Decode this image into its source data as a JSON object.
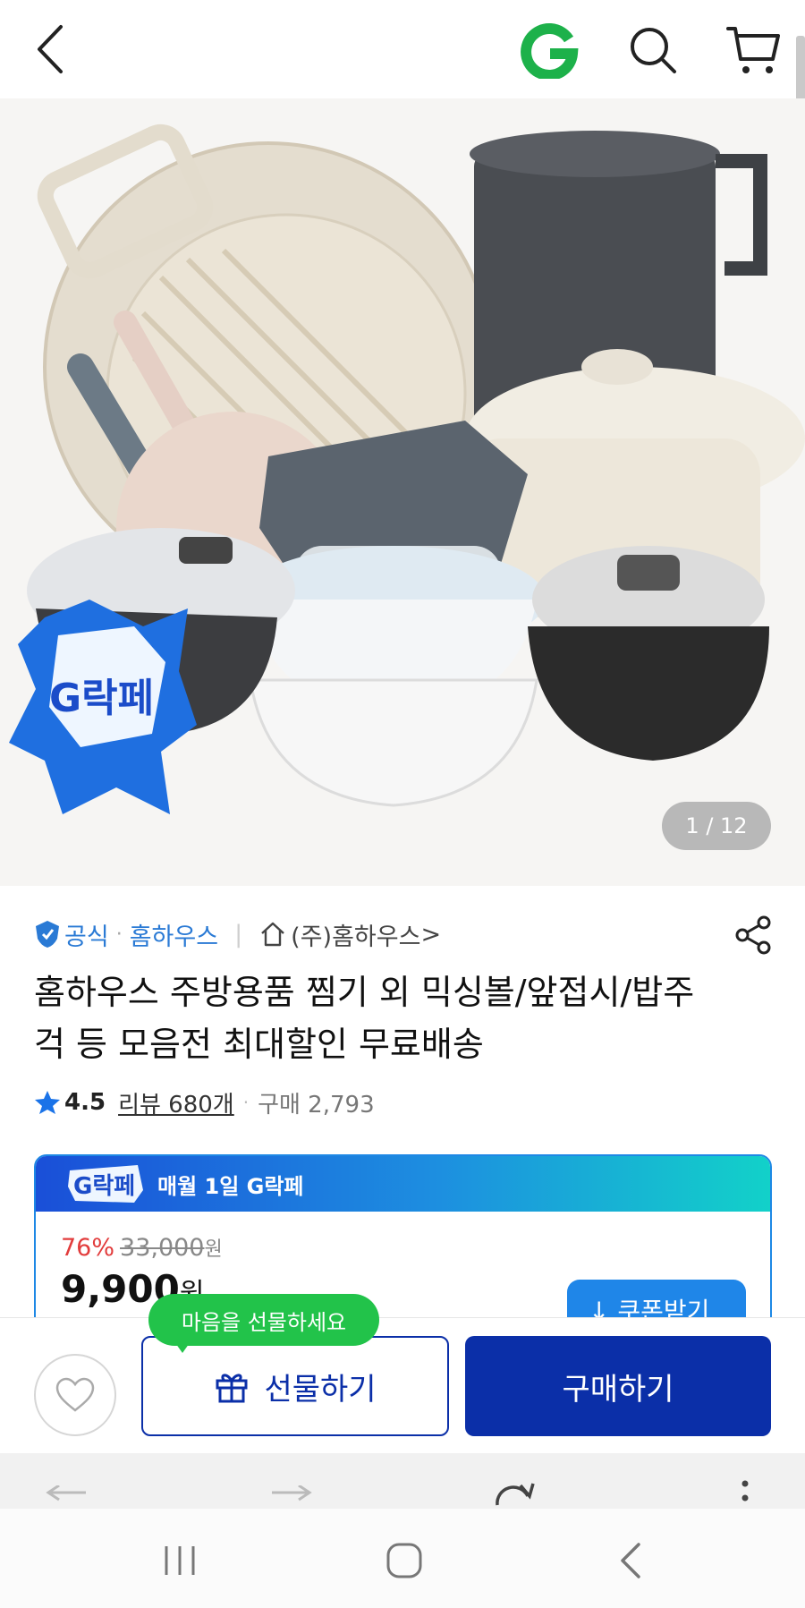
{
  "header": {
    "back_icon": "chevron-left-icon",
    "logo_icon": "g-logo-icon",
    "search_icon": "search-icon",
    "cart_icon": "cart-icon"
  },
  "gallery": {
    "counter": "1 / 12",
    "badge_text": "G락페"
  },
  "product": {
    "official_label": "공식",
    "brand_name": "홈하우스",
    "store_name": "(주)홈하우스",
    "store_chevron": ">",
    "title": "홈하우스 주방용품 찜기 외 믹싱볼/앞접시/밥주걱 등 모음전 최대할인 무료배송",
    "rating": "4.5",
    "reviews": "리뷰 680개",
    "purchases": "구매 2,793"
  },
  "promo": {
    "badge_text": "G락페",
    "header_text": "매월 1일 G락페",
    "discount": "76%",
    "original_price": "33,000",
    "original_won": "원",
    "price": "9,900",
    "price_won": "원",
    "coupon_label": "↓ 쿠폰받기"
  },
  "actions": {
    "tooltip": "마음을 선물하세요",
    "gift_label": "선물하기",
    "buy_label": "구매하기"
  },
  "colors": {
    "primary_blue": "#0b2fa8",
    "link_blue": "#2a7ad5",
    "sale_red": "#e23c3c",
    "tooltip_green": "#22c34a"
  }
}
